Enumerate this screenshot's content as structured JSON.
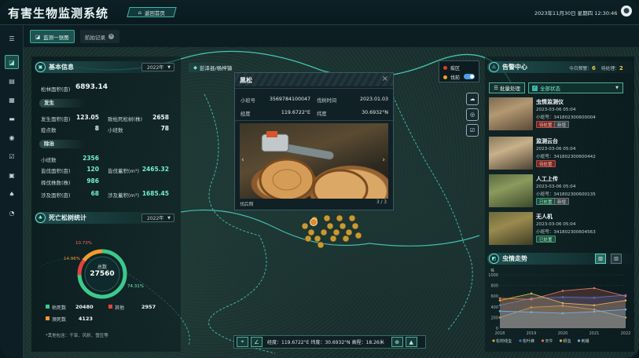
{
  "header": {
    "title": "有害生物监测系统",
    "home_label": "返回首页",
    "datetime": "2023年11月30日 星期四 12:30:46"
  },
  "tabs": [
    {
      "label": "监测一张图"
    },
    {
      "label": "航拍记录"
    }
  ],
  "basic_info": {
    "title": "基本信息",
    "year": "2022年",
    "pine_area_label": "松林面积(亩)",
    "pine_area_value": "6893.14",
    "occurrence_head": "发生",
    "occurrence": [
      {
        "label": "发生面积(亩)",
        "value": "123.05"
      },
      {
        "label": "致枯死松树(株)",
        "value": "2658"
      },
      {
        "label": "疫点数",
        "value": "8"
      },
      {
        "label": "小班数",
        "value": "78"
      }
    ],
    "removal_head": "除治",
    "removal": [
      {
        "label": "小班数",
        "value": "2356"
      },
      {
        "label": "皆伐面积(亩)",
        "value": "120"
      },
      {
        "label": "皆伐蓄积(m³)",
        "value": "2465.32"
      },
      {
        "label": "择伐株数(株)",
        "value": "986"
      },
      {
        "label": "涉及面积(亩)",
        "value": "68"
      },
      {
        "label": "涉及蓄积(m³)",
        "value": "1685.45"
      }
    ]
  },
  "dead_pine": {
    "title": "死亡松树统计",
    "year": "2022年",
    "total_label": "总数",
    "total_value": "27560",
    "pcts": {
      "red": "10.73%",
      "orange": "14.96%",
      "green": "74.31%"
    },
    "legend": [
      {
        "label": "枯死数",
        "value": "20480",
        "color": "#3cc98c"
      },
      {
        "label": "其他",
        "value": "2957",
        "color": "#e2433a"
      },
      {
        "label": "濒死数",
        "value": "4123",
        "color": "#f29a2e"
      }
    ],
    "note": "*其他包含：干旱、风折、雪压等"
  },
  "chart_values": {
    "red": 0.1073,
    "orange": 0.1496,
    "green": 0.7431
  },
  "location_label": "彭泽县/杨梓镇",
  "popup": {
    "title": "黑松",
    "rows": [
      {
        "k1": "小班号",
        "v1": "3569784100047",
        "k2": "伐树时间",
        "v2": "2023.01.03"
      },
      {
        "k1": "经度",
        "v1": "119.6722°E",
        "k2": "纬度",
        "v2": "30.6932°N"
      }
    ],
    "caption": "伐后照",
    "pager": "3 / 3"
  },
  "map_legend": [
    {
      "label": "疫区",
      "color": "#e23a2e"
    },
    {
      "label": "伐前",
      "color": "#f0a22e"
    }
  ],
  "toolbar": {
    "coords": "经度：119.6722°E  纬度：30.6932°N  高程：18.26米"
  },
  "alarm": {
    "title": "告警中心",
    "today_label": "今日预警：",
    "today_value": "6",
    "pending_label": "待处理：",
    "pending_value": "2",
    "batch_label": "批量处理",
    "filter_label": "全部状态",
    "items": [
      {
        "name": "虫情监测仪",
        "date": "2023-03-06 05:04",
        "no": "小班号：341802300600004",
        "badges": [
          "待处置",
          "新增"
        ]
      },
      {
        "name": "监测云台",
        "date": "2023-03-06 05:04",
        "no": "小班号：341802300600442",
        "badges": [
          "待处置"
        ]
      },
      {
        "name": "人工上传",
        "date": "2023-03-06 05:04",
        "no": "小班号：341802300600135",
        "badges": [
          "已处置",
          "新增"
        ]
      },
      {
        "name": "无人机",
        "date": "2023-03-06 05:04",
        "no": "小班号：341802300604563",
        "badges": [
          "已处置"
        ]
      }
    ]
  },
  "trend": {
    "title": "虫情走势",
    "y_ticks": [
      "1000",
      "800",
      "600",
      "400",
      "200",
      "0"
    ],
    "y_unit": "株"
  },
  "chart_data": {
    "type": "area",
    "title": "虫情走势",
    "x": [
      "2018",
      "2019",
      "2020",
      "2021",
      "2022"
    ],
    "ylim": [
      0,
      1000
    ],
    "series": [
      {
        "name": "松材线虫",
        "values": [
          200,
          390,
          420,
          350,
          200
        ]
      },
      {
        "name": "松叶蜂",
        "values": [
          430,
          560,
          580,
          570,
          620
        ]
      },
      {
        "name": "天牛",
        "values": [
          560,
          540,
          700,
          750,
          600
        ]
      },
      {
        "name": "蚜虫",
        "values": [
          520,
          650,
          470,
          430,
          520
        ]
      },
      {
        "name": "刺蛾",
        "values": [
          320,
          300,
          280,
          310,
          350
        ]
      }
    ],
    "colors": [
      "#d0a24a",
      "#3a6fe0",
      "#e06f5f",
      "#d7b55a",
      "#6ab0e8"
    ]
  }
}
